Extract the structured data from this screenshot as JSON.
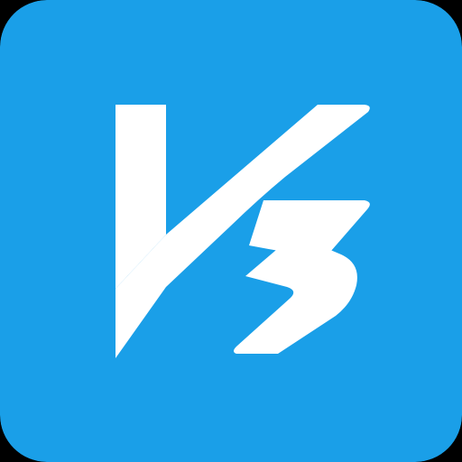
{
  "icon": {
    "name": "v3-app-icon",
    "logo_text": "V3",
    "colors": {
      "background": "#1A9FE8",
      "logo": "#FFFFFF",
      "page": "#000000"
    }
  }
}
